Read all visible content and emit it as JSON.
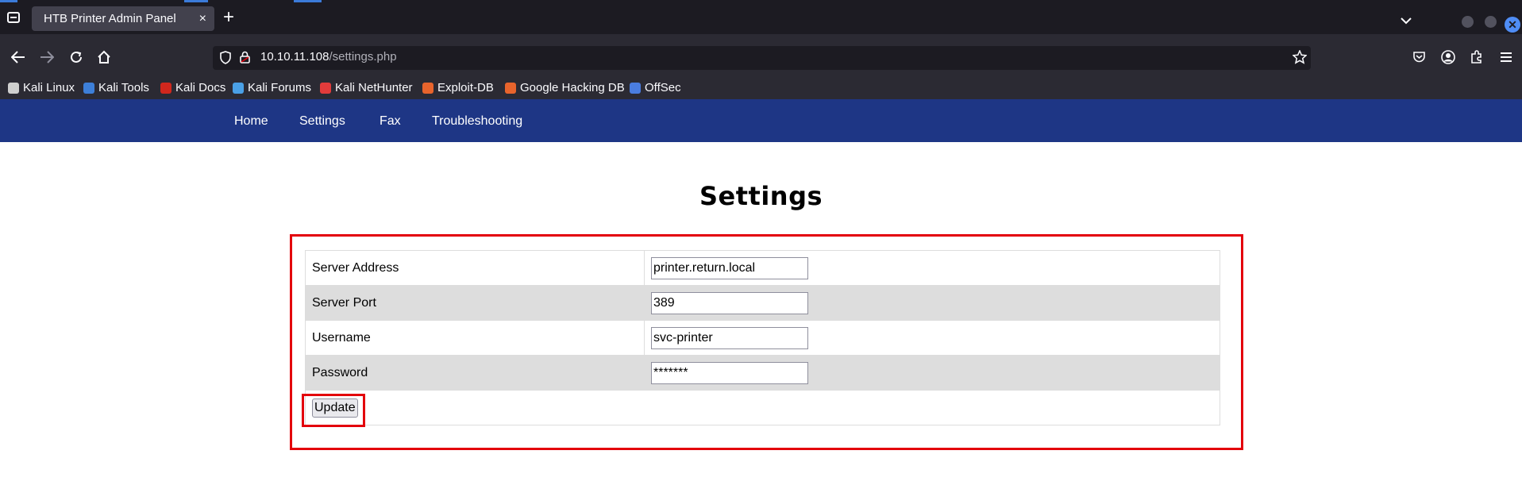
{
  "browser": {
    "tab_title": "HTB Printer Admin Panel",
    "tab_close": "×",
    "new_tab": "+",
    "url_host": "10.10.11.108",
    "url_path": "/settings.php",
    "bookmarks": [
      {
        "label": "Kali Linux",
        "icon_color": "#cfcfcf"
      },
      {
        "label": "Kali Tools",
        "icon_color": "#3d7fd9"
      },
      {
        "label": "Kali Docs",
        "icon_color": "#d0271d"
      },
      {
        "label": "Kali Forums",
        "icon_color": "#4aa0e6"
      },
      {
        "label": "Kali NetHunter",
        "icon_color": "#e23b3b"
      },
      {
        "label": "Exploit-DB",
        "icon_color": "#e8642c"
      },
      {
        "label": "Google Hacking DB",
        "icon_color": "#e8642c"
      },
      {
        "label": "OffSec",
        "icon_color": "#4a7de0"
      }
    ]
  },
  "site": {
    "nav": [
      "Home",
      "Settings",
      "Fax",
      "Troubleshooting"
    ],
    "nav_color": "#1e3685",
    "page_title": "Settings",
    "form": {
      "rows": [
        {
          "label": "Server Address",
          "value": "printer.return.local"
        },
        {
          "label": "Server Port",
          "value": "389"
        },
        {
          "label": "Username",
          "value": "svc-printer"
        },
        {
          "label": "Password",
          "value": "*******"
        }
      ],
      "submit_label": "Update"
    },
    "highlight_color": "#e3000b"
  }
}
